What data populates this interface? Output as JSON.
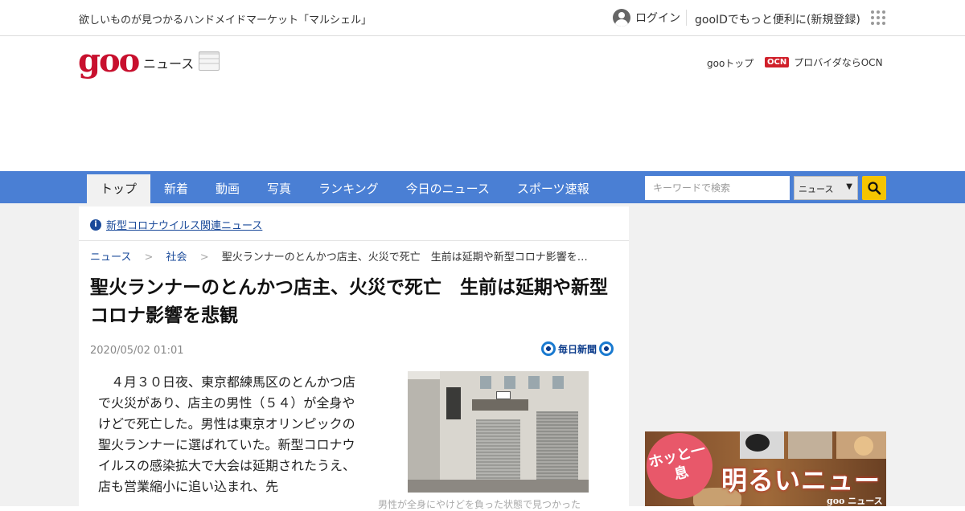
{
  "topbar": {
    "promo": "欲しいものが見つかるハンドメイドマーケット「マルシェル」",
    "login_label": "ログイン",
    "register_label": "gooIDでもっと便利に(新規登録)"
  },
  "header": {
    "logo_text": "goo",
    "logo_sub": "ニュース",
    "goo_top": "gooトップ",
    "ocn_logo": "OCN",
    "ocn_label": "プロバイダならOCN"
  },
  "nav": {
    "tabs": [
      {
        "label": "トップ",
        "active": true
      },
      {
        "label": "新着"
      },
      {
        "label": "動画"
      },
      {
        "label": "写真"
      },
      {
        "label": "ランキング"
      },
      {
        "label": "今日のニュース"
      },
      {
        "label": "スポーツ速報"
      }
    ],
    "search_placeholder": "キーワードで検索",
    "search_scope": "ニュース"
  },
  "article": {
    "covid_link": "新型コロナウイルス関連ニュース",
    "breadcrumb": [
      "ニュース",
      "社会",
      "聖火ランナーのとんかつ店主、火災で死亡　生前は延期や新型コロナ影響を…"
    ],
    "headline": "聖火ランナーのとんかつ店主、火災で死亡　生前は延期や新型コロナ影響を悲観",
    "date": "2020/05/02 01:01",
    "publisher": "毎日新聞",
    "body": "４月３０日夜、東京都練馬区のとんかつ店で火災があり、店主の男性（５４）が全身やけどで死亡した。男性は東京オリンピックの聖火ランナーに選ばれていた。新型コロナウイルスの感染拡大で大会は延期されたうえ、店も営業縮小に追い込まれ、先",
    "caption": "男性が全身にやけどを負った状態で見つかった"
  },
  "banner": {
    "bubble": "ホッと一息",
    "title": "明るいニュース",
    "brand": "goo ニュース"
  }
}
